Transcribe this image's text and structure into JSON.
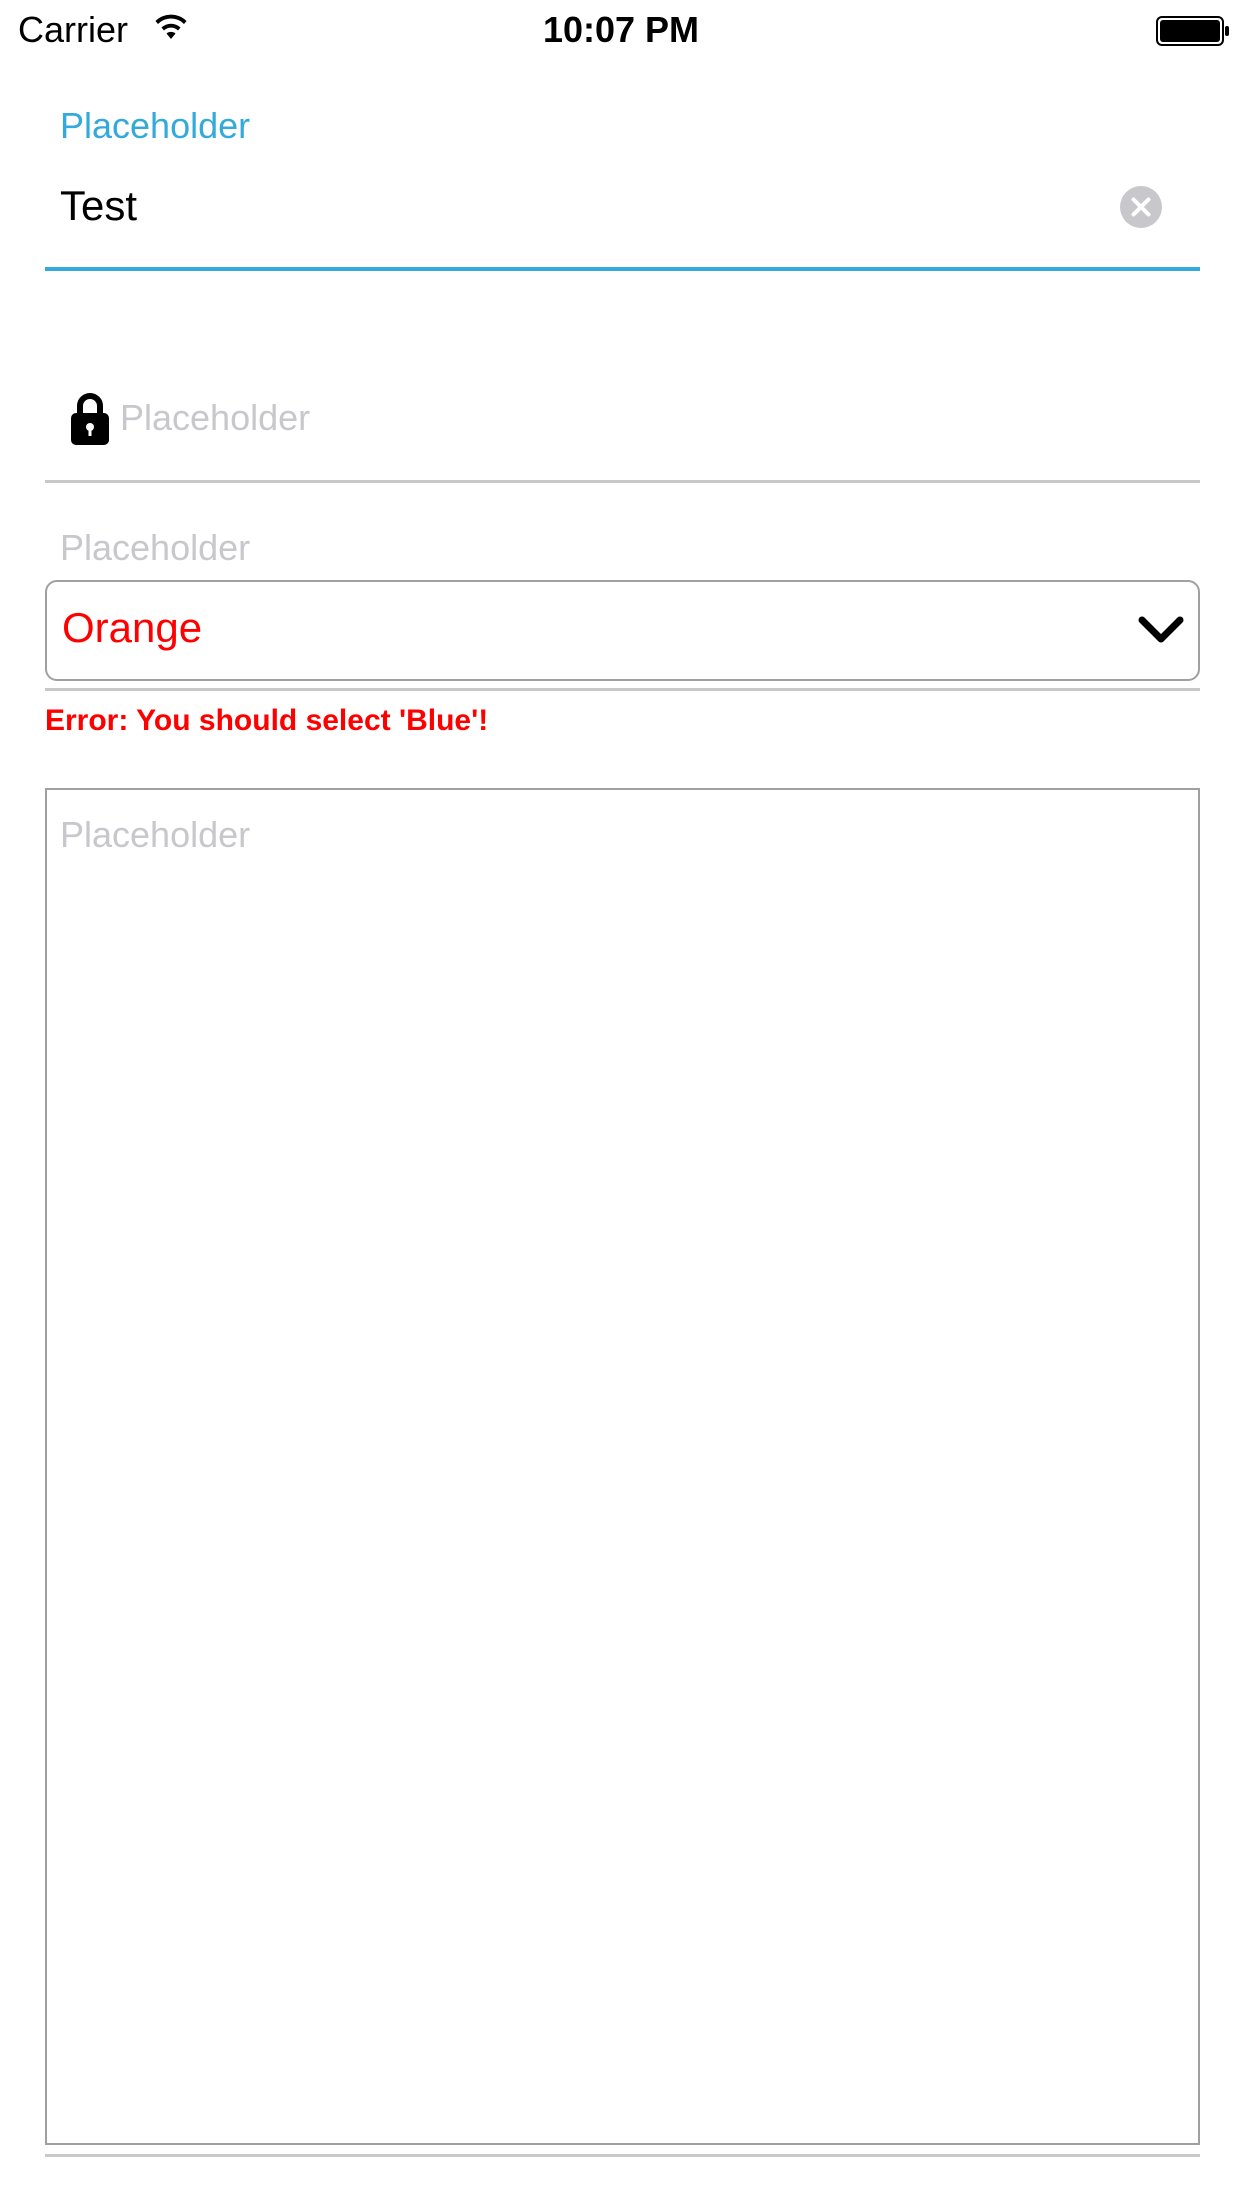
{
  "status_bar": {
    "carrier": "Carrier",
    "time": "10:07 PM",
    "wifi_icon": "wifi-icon",
    "battery_icon": "battery-icon"
  },
  "field1": {
    "floating_label": "Placeholder",
    "value": "Test",
    "clear_icon": "clear-circle-icon",
    "accent_color": "#34aadc"
  },
  "field2": {
    "icon": "lock-icon",
    "placeholder": "Placeholder"
  },
  "field3": {
    "label": "Placeholder",
    "selected_value": "Orange",
    "dropdown_icon": "chevron-down-icon",
    "error_message": "Error: You should select 'Blue'!",
    "error_color": "#ff0000"
  },
  "field4": {
    "placeholder": "Placeholder"
  }
}
